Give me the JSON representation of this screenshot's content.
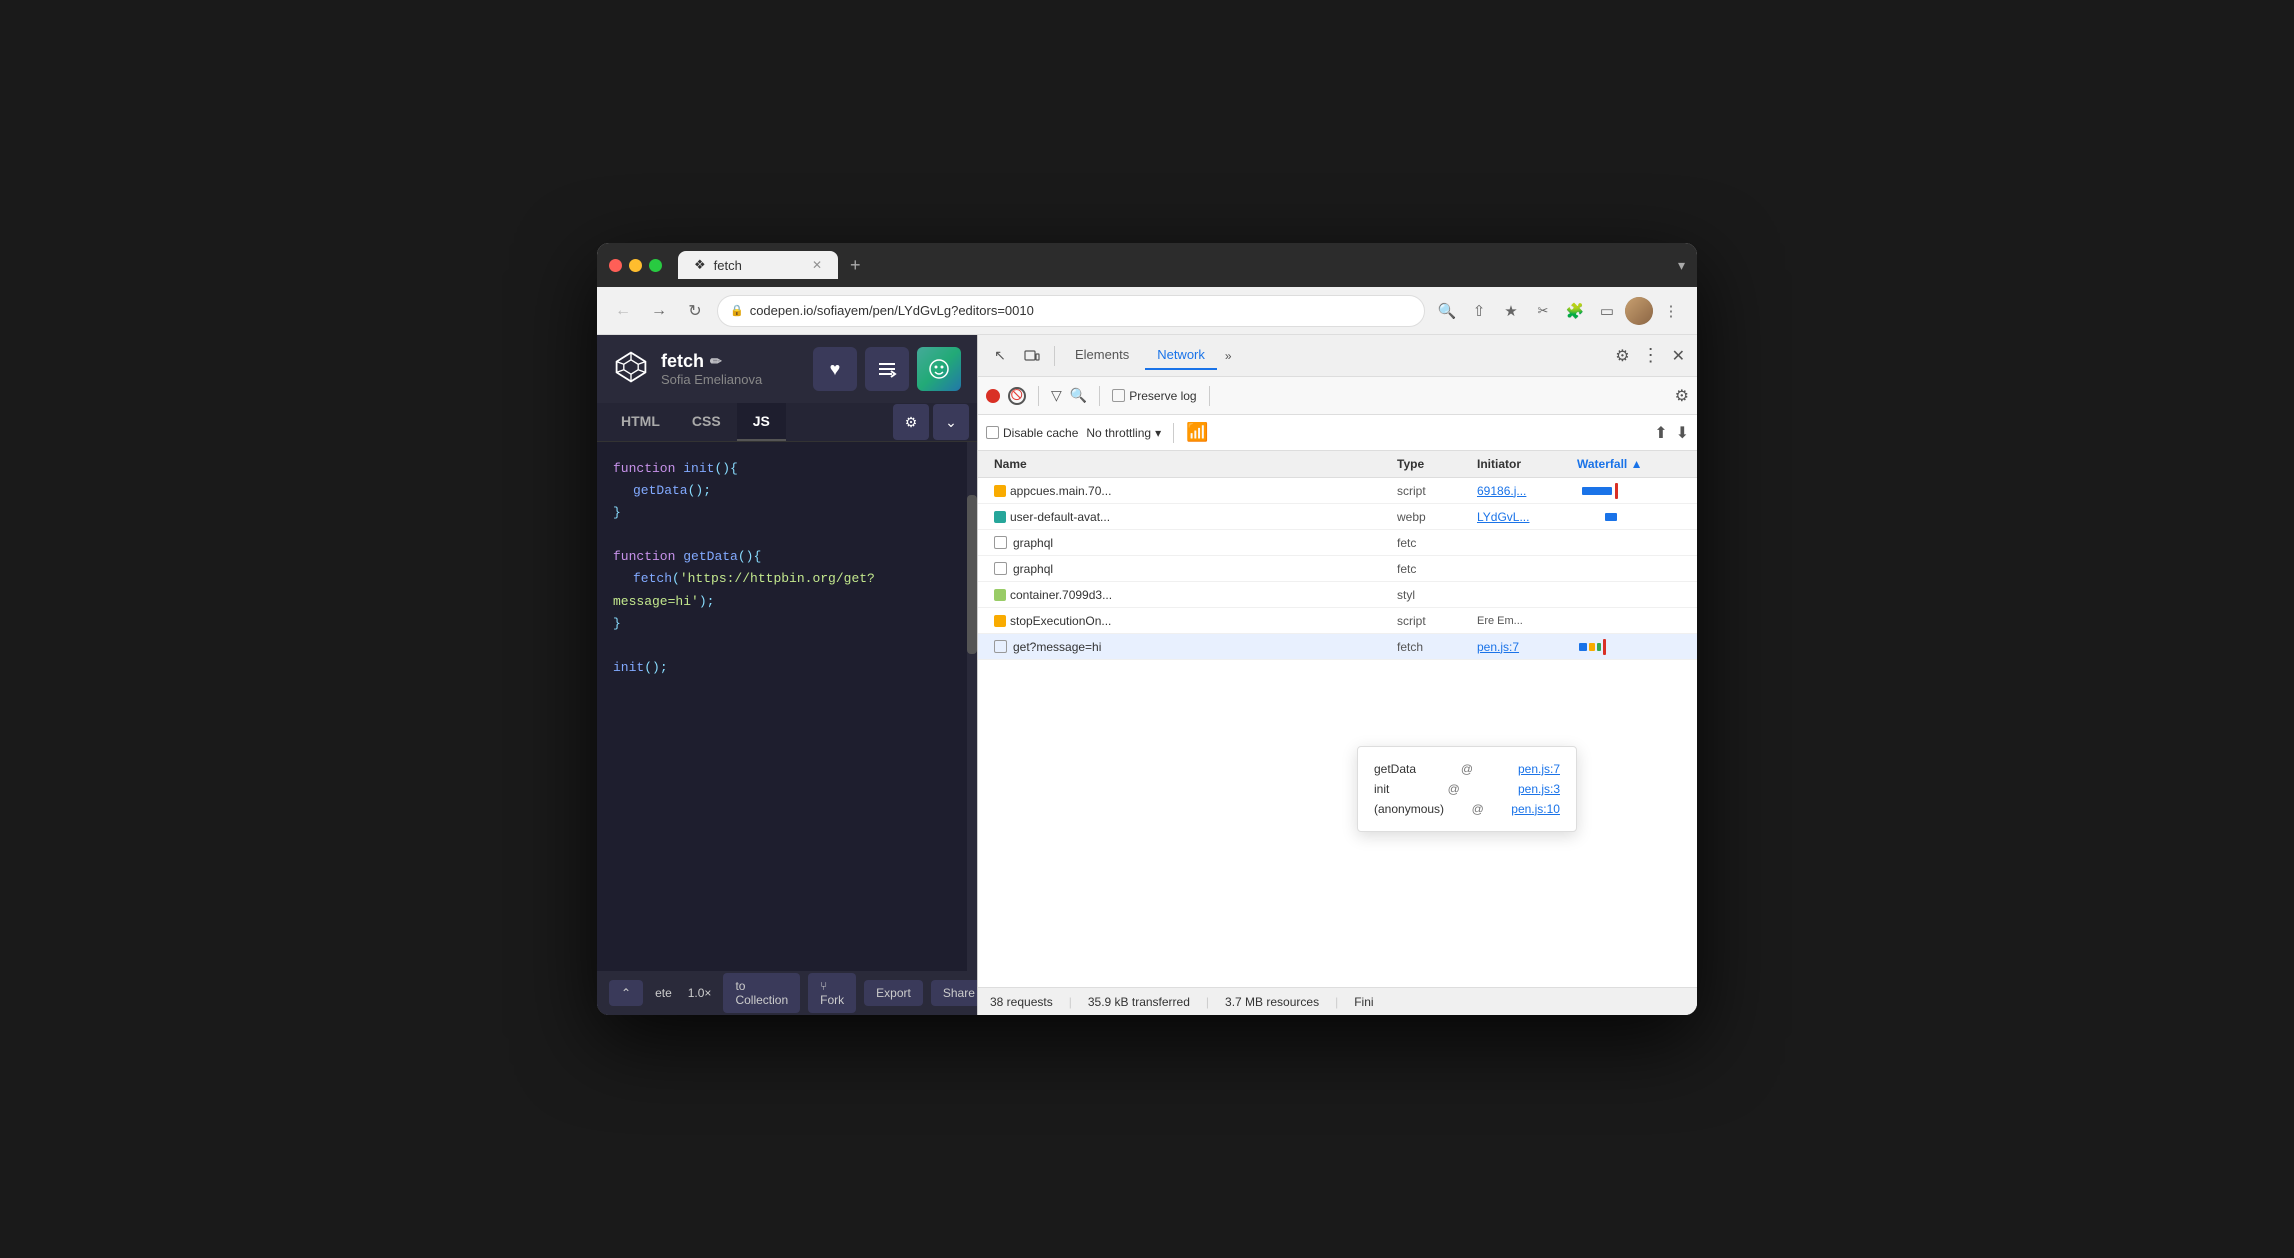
{
  "browser": {
    "tab_title": "fetch",
    "tab_new_label": "+",
    "tab_chevron": "▾",
    "url": "codepen.io/sofiayem/pen/LYdGvLg?editors=0010",
    "url_protocol": "https"
  },
  "codepen": {
    "title": "fetch",
    "edit_icon": "✏",
    "author": "Sofia Emelianova",
    "tab_html": "HTML",
    "tab_css": "CSS",
    "tab_js": "JS",
    "code_lines": [
      "function init(){",
      "  getData();",
      "}",
      "",
      "function getData(){",
      "  fetch('https://httpbin.org/get?message=hi');",
      "}",
      "",
      "init();"
    ],
    "footer_arrow": "⌃",
    "footer_label": "ete",
    "footer_zoom": "1.0×",
    "footer_collection": "to Collection",
    "footer_fork": "⑂ Fork",
    "footer_export": "Export",
    "footer_share": "Share"
  },
  "devtools": {
    "toolbar": {
      "inspect_icon": "↖",
      "device_icon": "□",
      "tab_elements": "Elements",
      "tab_network": "Network",
      "tab_more": "»",
      "settings_icon": "⚙",
      "menu_icon": "⋮",
      "close_icon": "✕"
    },
    "controls": {
      "record_tooltip": "Record",
      "stop_tooltip": "Stop",
      "filter_tooltip": "Filter",
      "search_tooltip": "Search",
      "preserve_log": "Preserve log",
      "settings_icon": "⚙"
    },
    "filters": {
      "disable_cache": "Disable cache",
      "no_throttling": "No throttling",
      "wifi_icon": "WiFi"
    },
    "table": {
      "headers": [
        "Name",
        "Type",
        "Initiator",
        "Waterfall"
      ],
      "rows": [
        {
          "name": "appcues.main.70...",
          "icon": "orange",
          "type": "script",
          "initiator": "69186.j...",
          "initiator_link": true,
          "has_waterfall": true
        },
        {
          "name": "user-default-avat...",
          "icon": "teal",
          "type": "webp",
          "initiator": "LYdGvL...",
          "initiator_link": true,
          "has_waterfall": true
        },
        {
          "name": "graphql",
          "icon": "none",
          "type": "fetc",
          "initiator": "",
          "initiator_link": false,
          "has_waterfall": false,
          "has_checkbox": true
        },
        {
          "name": "graphql",
          "icon": "none",
          "type": "fetc",
          "initiator": "",
          "initiator_link": false,
          "has_waterfall": false,
          "has_checkbox": true
        },
        {
          "name": "container.7099d3...",
          "icon": "purple",
          "type": "styl",
          "initiator": "",
          "initiator_link": false,
          "has_waterfall": false
        },
        {
          "name": "stopExecutionOn...",
          "icon": "orange",
          "type": "script",
          "initiator": "Ere  Em...",
          "initiator_link": false,
          "has_waterfall": false
        },
        {
          "name": "get?message=hi",
          "icon": "none",
          "type": "fetch",
          "initiator": "pen.js:7",
          "initiator_link": true,
          "has_waterfall": true,
          "has_checkbox": true,
          "is_selected": true
        }
      ]
    },
    "call_stack": {
      "title": "",
      "rows": [
        {
          "fn": "getData",
          "at": "@",
          "link": "pen.js:7"
        },
        {
          "fn": "init",
          "at": "@",
          "link": "pen.js:3"
        },
        {
          "fn": "(anonymous)",
          "at": "@",
          "link": "pen.js:10"
        }
      ]
    },
    "status": {
      "requests": "38 requests",
      "transferred": "35.9 kB transferred",
      "resources": "3.7 MB resources",
      "finish": "Fini"
    }
  }
}
